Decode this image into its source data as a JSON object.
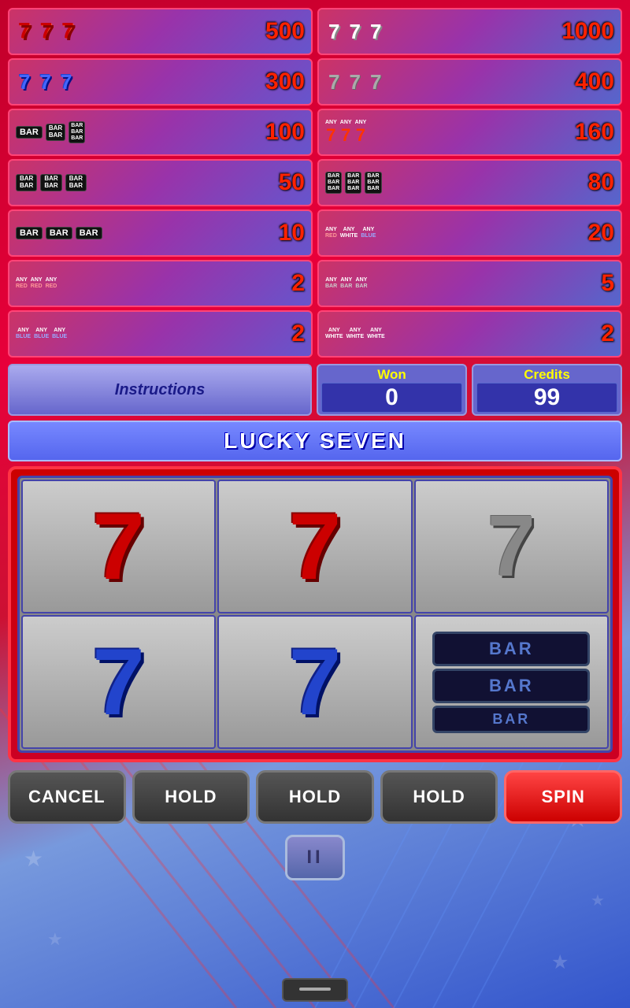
{
  "title": "LUCKY SEVEN",
  "paytable": {
    "rows": [
      {
        "left": {
          "symbols": [
            "7r",
            "7r",
            "7r"
          ],
          "value": "500"
        },
        "right": {
          "symbols": [
            "7w",
            "7w",
            "7w"
          ],
          "value": "1000"
        }
      },
      {
        "left": {
          "symbols": [
            "7b",
            "7b",
            "7b"
          ],
          "value": "300"
        },
        "right": {
          "symbols": [
            "7g",
            "7g",
            "7g"
          ],
          "value": "400"
        }
      },
      {
        "left": {
          "symbols": [
            "bar1",
            "bar2",
            "bar3"
          ],
          "value": "100"
        },
        "right": {
          "symbols": [
            "any7",
            "any7",
            "any7"
          ],
          "value": "160"
        }
      },
      {
        "left": {
          "symbols": [
            "bar2x",
            "bar2x",
            "bar2x"
          ],
          "value": "50"
        },
        "right": {
          "symbols": [
            "bar3x",
            "bar3x",
            "bar3x"
          ],
          "value": "80"
        }
      },
      {
        "left": {
          "symbols": [
            "bar1x",
            "bar1x",
            "bar1"
          ],
          "value": "10"
        },
        "right": {
          "symbols": [
            "anyR",
            "anyW",
            "anyB"
          ],
          "value": "20"
        }
      },
      {
        "left": {
          "symbols": [
            "anyRed",
            "anyRed",
            "anyRed"
          ],
          "value": "2"
        },
        "right": {
          "symbols": [
            "anyBar",
            "anyBar",
            "anyBar"
          ],
          "value": "5"
        }
      },
      {
        "left": {
          "symbols": [
            "anyBlue",
            "anyBlue",
            "anyBlue"
          ],
          "value": "2"
        },
        "right": {
          "symbols": [
            "anyWhite",
            "anyWhite",
            "anyWhite"
          ],
          "value": "2"
        }
      }
    ]
  },
  "labels": {
    "instructions": "Instructions",
    "won": "Won",
    "credits": "Credits",
    "won_value": "0",
    "credits_value": "99",
    "game_name": "LUCKY  SEVEN"
  },
  "reels": {
    "rows": [
      [
        "red7",
        "red7",
        "gray7"
      ],
      [
        "blue7",
        "blue7",
        "doubleBar"
      ]
    ]
  },
  "buttons": {
    "cancel": "CANCEL",
    "hold1": "HOLD",
    "hold2": "HOLD",
    "hold3": "HOLD",
    "spin": "SPIN",
    "pause": "II"
  }
}
